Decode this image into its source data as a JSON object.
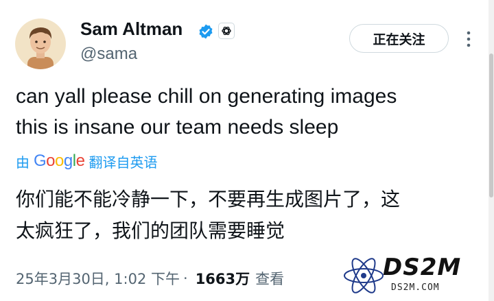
{
  "author": {
    "name": "Sam Altman",
    "handle": "@sama",
    "verified_icon": "verified-badge-icon",
    "affiliate_icon": "openai-logo-icon",
    "verified_color": "#1d9bf0"
  },
  "follow_button": {
    "label": "正在关注"
  },
  "more_menu": {
    "icon": "more-vertical-icon"
  },
  "tweet": {
    "lines": [
      "can yall please chill on generating images",
      "this is insane our team needs sleep"
    ]
  },
  "translation": {
    "prefix": "由",
    "provider": "Google",
    "provider_letters": [
      "G",
      "o",
      "o",
      "g",
      "l",
      "e"
    ],
    "suffix": "翻译自英语",
    "link_color": "#1d9bf0",
    "lines": [
      "你们能不能冷静一下，不要再生成图片了，这",
      "太疯狂了，我们的团队需要睡觉"
    ]
  },
  "meta": {
    "date": "25年3月30日, 1:02 下午",
    "separator": "·",
    "views_count": "1663万",
    "views_label": "查看"
  },
  "watermark": {
    "brand": "DS2M",
    "site": "DS2M.COM"
  },
  "colors": {
    "text": "#0f1419",
    "secondary": "#536471",
    "border": "#cfd9de"
  }
}
